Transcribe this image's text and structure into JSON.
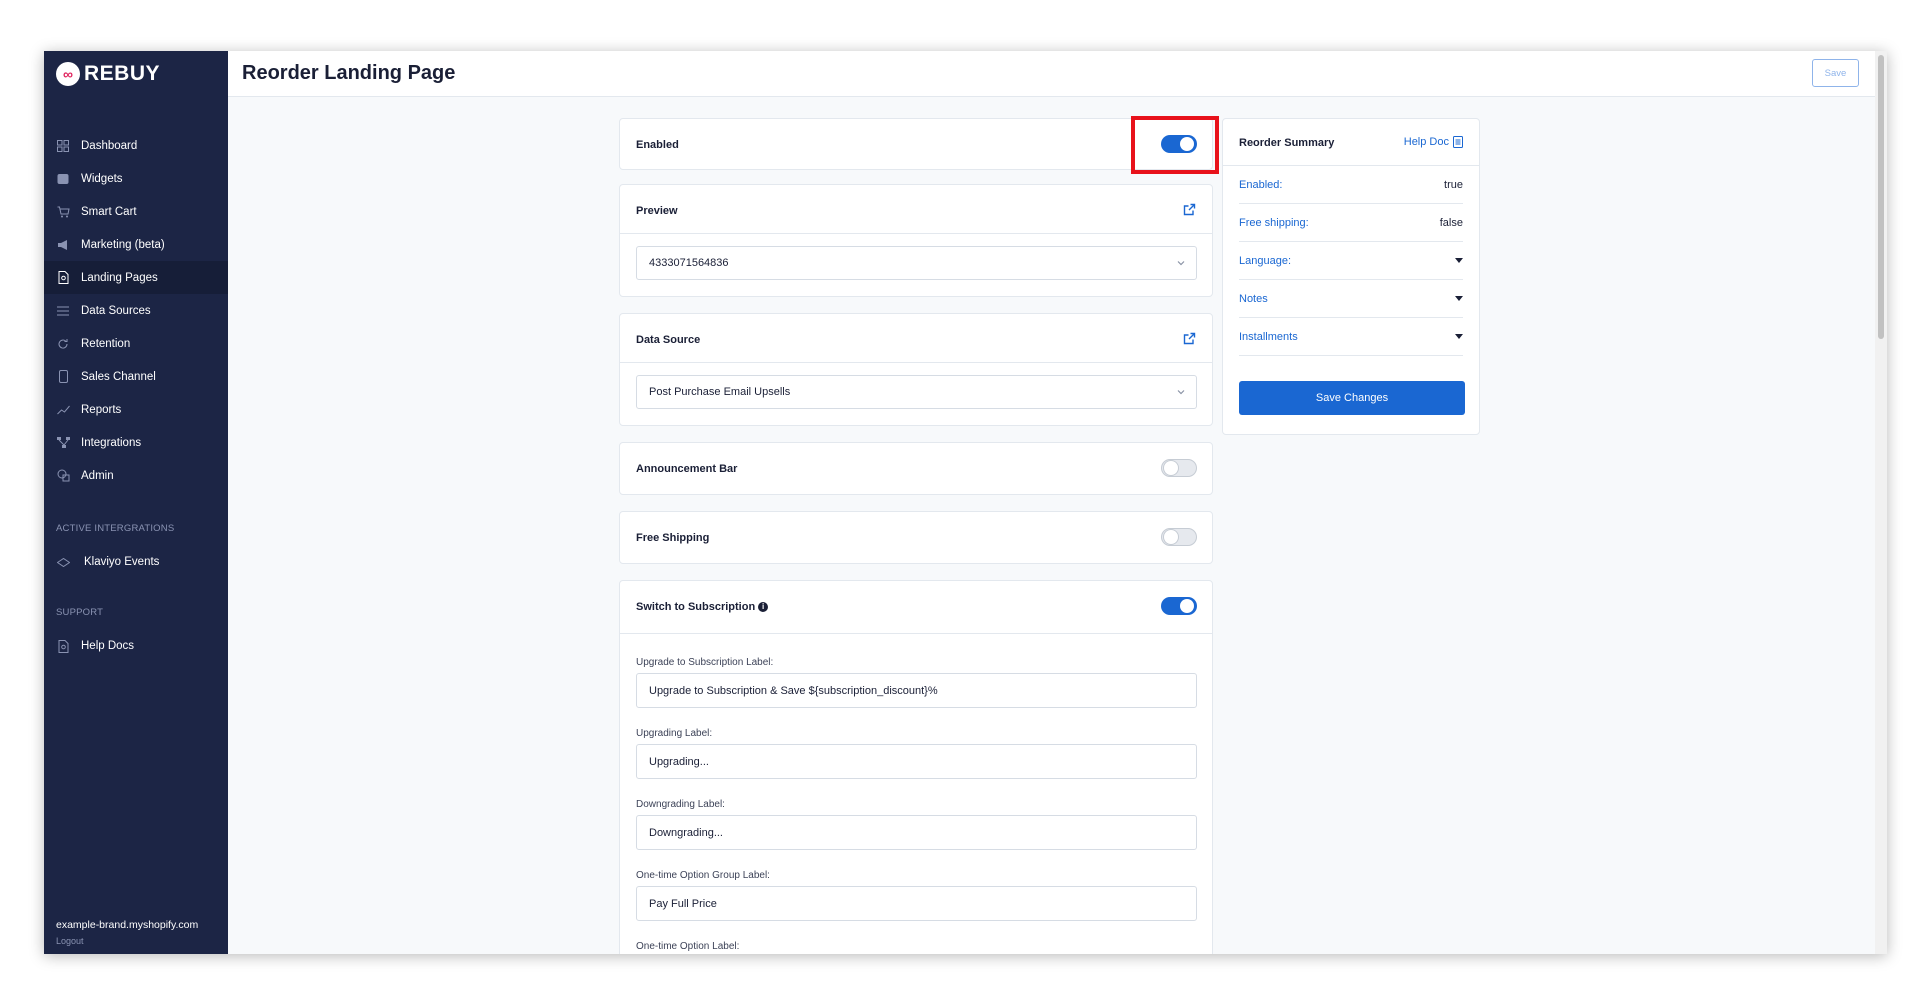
{
  "app": {
    "brand": "REBUY"
  },
  "sidebar": {
    "items": [
      {
        "label": "Dashboard",
        "icon": "grid-icon"
      },
      {
        "label": "Widgets",
        "icon": "widgets-icon"
      },
      {
        "label": "Smart Cart",
        "icon": "cart-icon"
      },
      {
        "label": "Marketing (beta)",
        "icon": "megaphone-icon"
      },
      {
        "label": "Landing Pages",
        "icon": "page-icon",
        "active": true
      },
      {
        "label": "Data Sources",
        "icon": "list-icon"
      },
      {
        "label": "Retention",
        "icon": "refresh-icon"
      },
      {
        "label": "Sales Channel",
        "icon": "phone-icon"
      },
      {
        "label": "Reports",
        "icon": "chart-line-icon"
      },
      {
        "label": "Integrations",
        "icon": "network-icon"
      },
      {
        "label": "Admin",
        "icon": "shapes-icon"
      }
    ],
    "active_integrations_heading": "ACTIVE INTERGRATIONS",
    "integration_item": "Klaviyo Events",
    "support_heading": "SUPPORT",
    "support_item": "Help Docs",
    "shop_domain": "example-brand.myshopify.com",
    "logout": "Logout"
  },
  "header": {
    "title": "Reorder Landing Page",
    "save_label": "Save"
  },
  "main": {
    "enabled": {
      "label": "Enabled",
      "on": true
    },
    "preview": {
      "label": "Preview",
      "selected": "4333071564836"
    },
    "data_source": {
      "label": "Data Source",
      "selected": "Post Purchase Email Upsells"
    },
    "announcement_bar": {
      "label": "Announcement Bar",
      "on": false
    },
    "free_shipping": {
      "label": "Free Shipping",
      "on": false
    },
    "switch_subscription": {
      "label": "Switch to Subscription",
      "on": true
    },
    "fields": [
      {
        "label": "Upgrade to Subscription Label:",
        "value": "Upgrade to Subscription & Save ${subscription_discount}%"
      },
      {
        "label": "Upgrading Label:",
        "value": "Upgrading..."
      },
      {
        "label": "Downgrading Label:",
        "value": "Downgrading..."
      },
      {
        "label": "One-time Option Group Label:",
        "value": "Pay Full Price"
      },
      {
        "label": "One-time Option Label:",
        "value": ""
      }
    ]
  },
  "summary": {
    "title": "Reorder Summary",
    "help_doc": "Help Doc",
    "rows": [
      {
        "key": "Enabled:",
        "value": "true"
      },
      {
        "key": "Free shipping:",
        "value": "false"
      },
      {
        "key": "Language:",
        "value": ""
      },
      {
        "key": "Notes",
        "value": ""
      },
      {
        "key": "Installments",
        "value": ""
      }
    ],
    "save_changes": "Save Changes"
  },
  "colors": {
    "sidebar_bg": "#1c2545",
    "accent": "#1a67d2",
    "highlight": "#e8121b"
  }
}
